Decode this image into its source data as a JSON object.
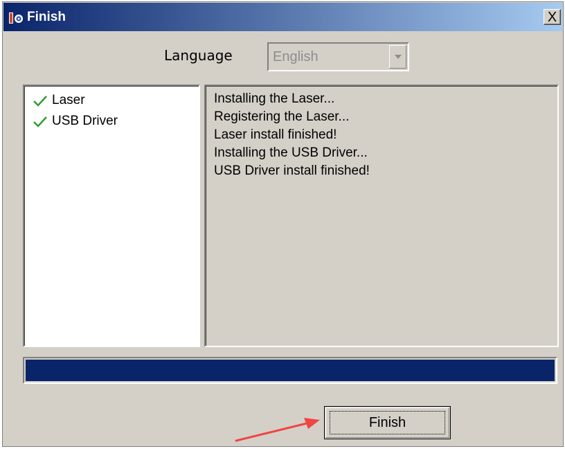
{
  "window": {
    "title": "Finish",
    "close_glyph": "X",
    "icon": "installer-app-icon"
  },
  "language": {
    "label": "Language",
    "selected": "English",
    "disabled": true
  },
  "components": [
    {
      "label": "Laser",
      "status": "installed",
      "icon": "check-icon"
    },
    {
      "label": "USB Driver",
      "status": "installed",
      "icon": "check-icon"
    }
  ],
  "log": [
    "Installing the Laser...",
    "Registering the Laser...",
    "Laser install finished!",
    "Installing the USB Driver...",
    "USB Driver install finished!"
  ],
  "progress": {
    "percent": 100,
    "color": "#0a246a"
  },
  "finish_button": {
    "label": "Finish"
  },
  "annotation": {
    "type": "arrow",
    "color": "#f04545",
    "points_to": "finish-button"
  },
  "colors": {
    "dialog_bg": "#d4d0c8",
    "title_gradient_start": "#0a246a",
    "title_gradient_end": "#a6caf0",
    "check_green": "#2e9e2e"
  }
}
